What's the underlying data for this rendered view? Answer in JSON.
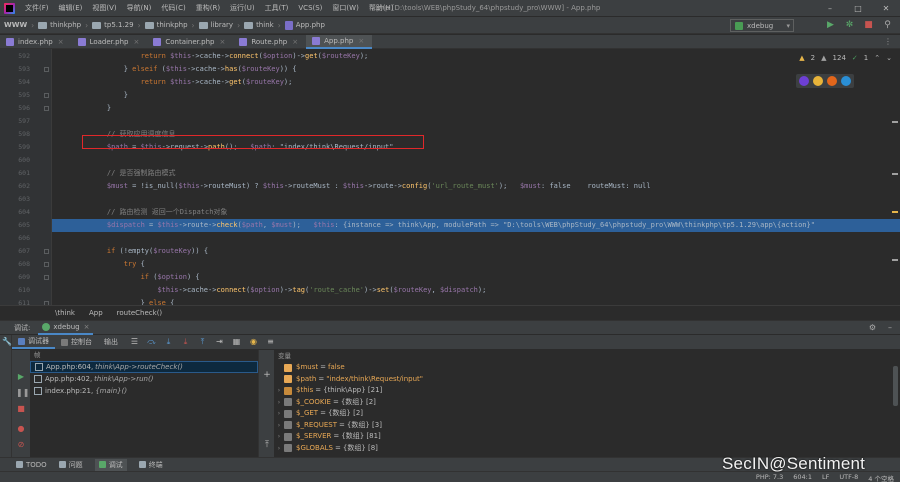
{
  "menubar": {
    "items": [
      "文件(F)",
      "编辑(E)",
      "视图(V)",
      "导航(N)",
      "代码(C)",
      "重构(R)",
      "运行(U)",
      "工具(T)",
      "VCS(S)",
      "窗口(W)",
      "帮助(H)"
    ],
    "title": "l.php [D:\\tools\\WEB\\phpStudy_64\\phpstudy_pro\\WWW] - App.php"
  },
  "navbar": {
    "crumbs": [
      "WWW",
      "thinkphp",
      "tp5.1.29",
      "thinkphp",
      "library",
      "think",
      "App.php"
    ],
    "run_config": "xdebug"
  },
  "tabs": [
    "index.php",
    "Loader.php",
    "Container.php",
    "Route.php",
    "App.php"
  ],
  "editor": {
    "indicators": {
      "warnings": "2",
      "weak_warnings": "124",
      "typos": "1"
    },
    "lines": [
      {
        "num": "592",
        "code": "            return $this->cache->connect($option)->get($routeKey);"
      },
      {
        "num": "593",
        "code": "        } elseif ($this->cache->has($routeKey)) {"
      },
      {
        "num": "594",
        "code": "            return $this->cache->get($routeKey);"
      },
      {
        "num": "595",
        "code": "        }"
      },
      {
        "num": "596",
        "code": "    }"
      },
      {
        "num": "597",
        "code": ""
      },
      {
        "num": "598",
        "code": "    // 获取应用调度信息"
      },
      {
        "num": "599",
        "code": "    $path = $this->request->path();   $path: \"index/think\\Request/input\""
      },
      {
        "num": "600",
        "code": ""
      },
      {
        "num": "601",
        "code": "    // 是否强制路由模式"
      },
      {
        "num": "602",
        "code": "    $must = !is_null($this->routeMust) ? $this->routeMust : $this->route->config('url_route_must');   $must: false    routeMust: null"
      },
      {
        "num": "603",
        "code": ""
      },
      {
        "num": "604",
        "code": "    // 路由检测 返回一个Dispatch对象"
      },
      {
        "num": "605",
        "code": "    $dispatch = $this->route->check($path, $must);   $this: {instance => think\\App, modulePath => \"D:\\tools\\WEB\\phpStudy_64\\phpstudy_pro\\WWW\\thinkphp\\tp5.1.29\\app\\{action}\""
      },
      {
        "num": "606",
        "code": ""
      },
      {
        "num": "607",
        "code": "    if (!empty($routeKey)) {"
      },
      {
        "num": "608",
        "code": "        try {"
      },
      {
        "num": "609",
        "code": "            if ($option) {"
      },
      {
        "num": "610",
        "code": "                $this->cache->connect($option)->tag('route_cache')->set($routeKey, $dispatch);"
      },
      {
        "num": "611",
        "code": "            } else {"
      }
    ]
  },
  "edit_crumb": [
    "\\think",
    "App",
    "routeCheck()"
  ],
  "debug": {
    "label": "调试:",
    "session": "xdebug",
    "tabs": [
      "调试器",
      "控制台",
      "输出"
    ],
    "frames_header": "帧",
    "frames": [
      {
        "loc": "App.php:604,",
        "fn": "think\\App->routeCheck()"
      },
      {
        "loc": "App.php:402,",
        "fn": "think\\App->run()"
      },
      {
        "loc": "index.php:21,",
        "fn": "{main}()"
      }
    ],
    "vars_header": "变量",
    "vars": [
      {
        "name": "$must",
        "eq": " = ",
        "val": "false",
        "type": ""
      },
      {
        "name": "$path",
        "eq": " = ",
        "val": "\"index/think\\Request/input\"",
        "type": ""
      },
      {
        "name": "$this",
        "eq": " = ",
        "val": "",
        "type": "{think\\App} [21]"
      },
      {
        "name": "$_COOKIE",
        "eq": " = ",
        "val": "",
        "type": "{数组} [2]"
      },
      {
        "name": "$_GET",
        "eq": " = ",
        "val": "",
        "type": "{数组} [2]"
      },
      {
        "name": "$_REQUEST",
        "eq": " = ",
        "val": "",
        "type": "{数组} [3]"
      },
      {
        "name": "$_SERVER",
        "eq": " = ",
        "val": "",
        "type": "{数组} [81]"
      },
      {
        "name": "$GLOBALS",
        "eq": " = ",
        "val": "",
        "type": "{数组} [8]"
      }
    ]
  },
  "bottom_tools": [
    "TODO",
    "问题",
    "调试",
    "终端"
  ],
  "status": {
    "php": "PHP: 7.3",
    "pos": "604:1",
    "lf": "LF",
    "enc": "UTF-8",
    "indent": "4 个空格"
  },
  "watermark": "SecIN@Sentiment",
  "colors": {
    "accent": "#4a88c7",
    "highlight": "#2d6099",
    "annotation": "#e0282a"
  }
}
